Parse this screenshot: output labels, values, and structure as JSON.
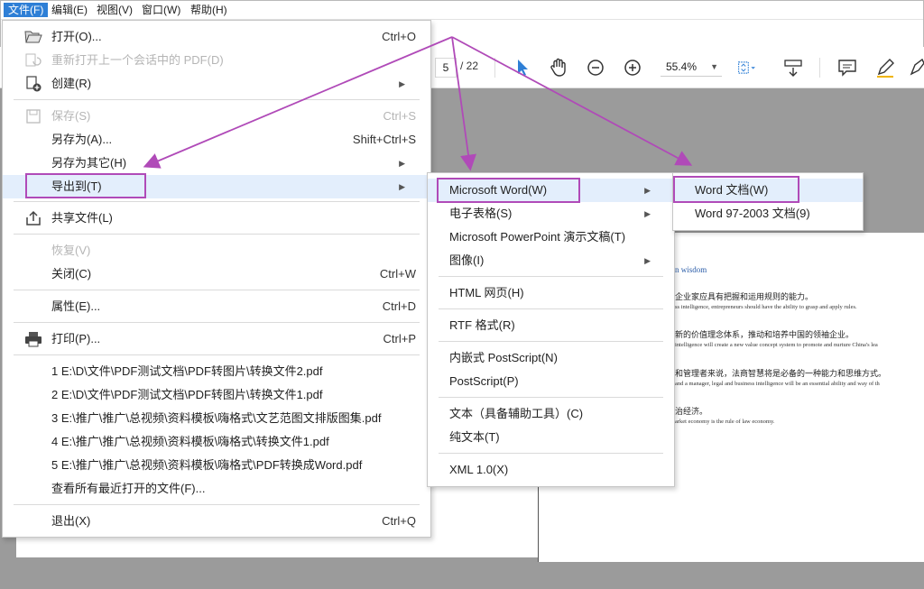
{
  "menubar": [
    "文件(F)",
    "编辑(E)",
    "视图(V)",
    "窗口(W)",
    "帮助(H)"
  ],
  "toolbar": {
    "page_current": "5",
    "page_total": "/ 22",
    "zoom": "55.4%"
  },
  "file_menu": {
    "open": {
      "label": "打开(O)...",
      "shortcut": "Ctrl+O"
    },
    "reopen": {
      "label": "重新打开上一个会话中的 PDF(D)"
    },
    "create": {
      "label": "创建(R)"
    },
    "save": {
      "label": "保存(S)",
      "shortcut": "Ctrl+S"
    },
    "save_as": {
      "label": "另存为(A)...",
      "shortcut": "Shift+Ctrl+S"
    },
    "save_as_other": {
      "label": "另存为其它(H)"
    },
    "export": {
      "label": "导出到(T)"
    },
    "share": {
      "label": "共享文件(L)"
    },
    "revert": {
      "label": "恢复(V)"
    },
    "close": {
      "label": "关闭(C)",
      "shortcut": "Ctrl+W"
    },
    "properties": {
      "label": "属性(E)...",
      "shortcut": "Ctrl+D"
    },
    "print": {
      "label": "打印(P)...",
      "shortcut": "Ctrl+P"
    },
    "recent": [
      "1 E:\\D\\文件\\PDF测试文档\\PDF转图片\\转换文件2.pdf",
      "2 E:\\D\\文件\\PDF测试文档\\PDF转图片\\转换文件1.pdf",
      "3 E:\\推广\\推广\\总视频\\资料模板\\嗨格式\\文艺范图文排版图集.pdf",
      "4 E:\\推广\\推广\\总视频\\资料模板\\嗨格式\\转换文件1.pdf",
      "5 E:\\推广\\推广\\总视频\\资料模板\\嗨格式\\PDF转换成Word.pdf"
    ],
    "view_all_recent": {
      "label": "查看所有最近打开的文件(F)..."
    },
    "exit": {
      "label": "退出(X)",
      "shortcut": "Ctrl+Q"
    }
  },
  "export_menu": {
    "word": "Microsoft Word(W)",
    "spreadsheet": "电子表格(S)",
    "powerpoint": "Microsoft PowerPoint 演示文稿(T)",
    "image": "图像(I)",
    "html": "HTML 网页(H)",
    "rtf": "RTF 格式(R)",
    "eps": "内嵌式 PostScript(N)",
    "ps": "PostScript(P)",
    "text_accessible": "文本（具备辅助工具）(C)",
    "plain_text": "纯文本(T)",
    "xml": "XML 1.0(X)"
  },
  "word_menu": {
    "docx": "Word 文档(W)",
    "doc": "Word 97-2003 文档(9)"
  },
  "document": {
    "heading": "n wisdom",
    "lines": [
      {
        "zh": "企业家应具有把握和运用规则的能力。",
        "en": "ss intelligence, entrepreneurs should have the ability to grasp and apply rules."
      },
      {
        "zh": "新的价值理念体系，推动和培养中国的领袖企业。",
        "en": "intelligence will create a new value concept system to promote and nurture China's lea"
      },
      {
        "zh": "和管理者来说，法商智慧将是必备的一种能力和思维方式。",
        "en": "and a manager, legal and business intelligence will be an essential ability and way of th"
      },
      {
        "zh": "治经济。",
        "en": "arket economy is the rule of law economy."
      }
    ]
  },
  "colors": {
    "accent": "#2e7fd6",
    "highlight": "#b04ab8",
    "hover": "#e3eefc"
  }
}
